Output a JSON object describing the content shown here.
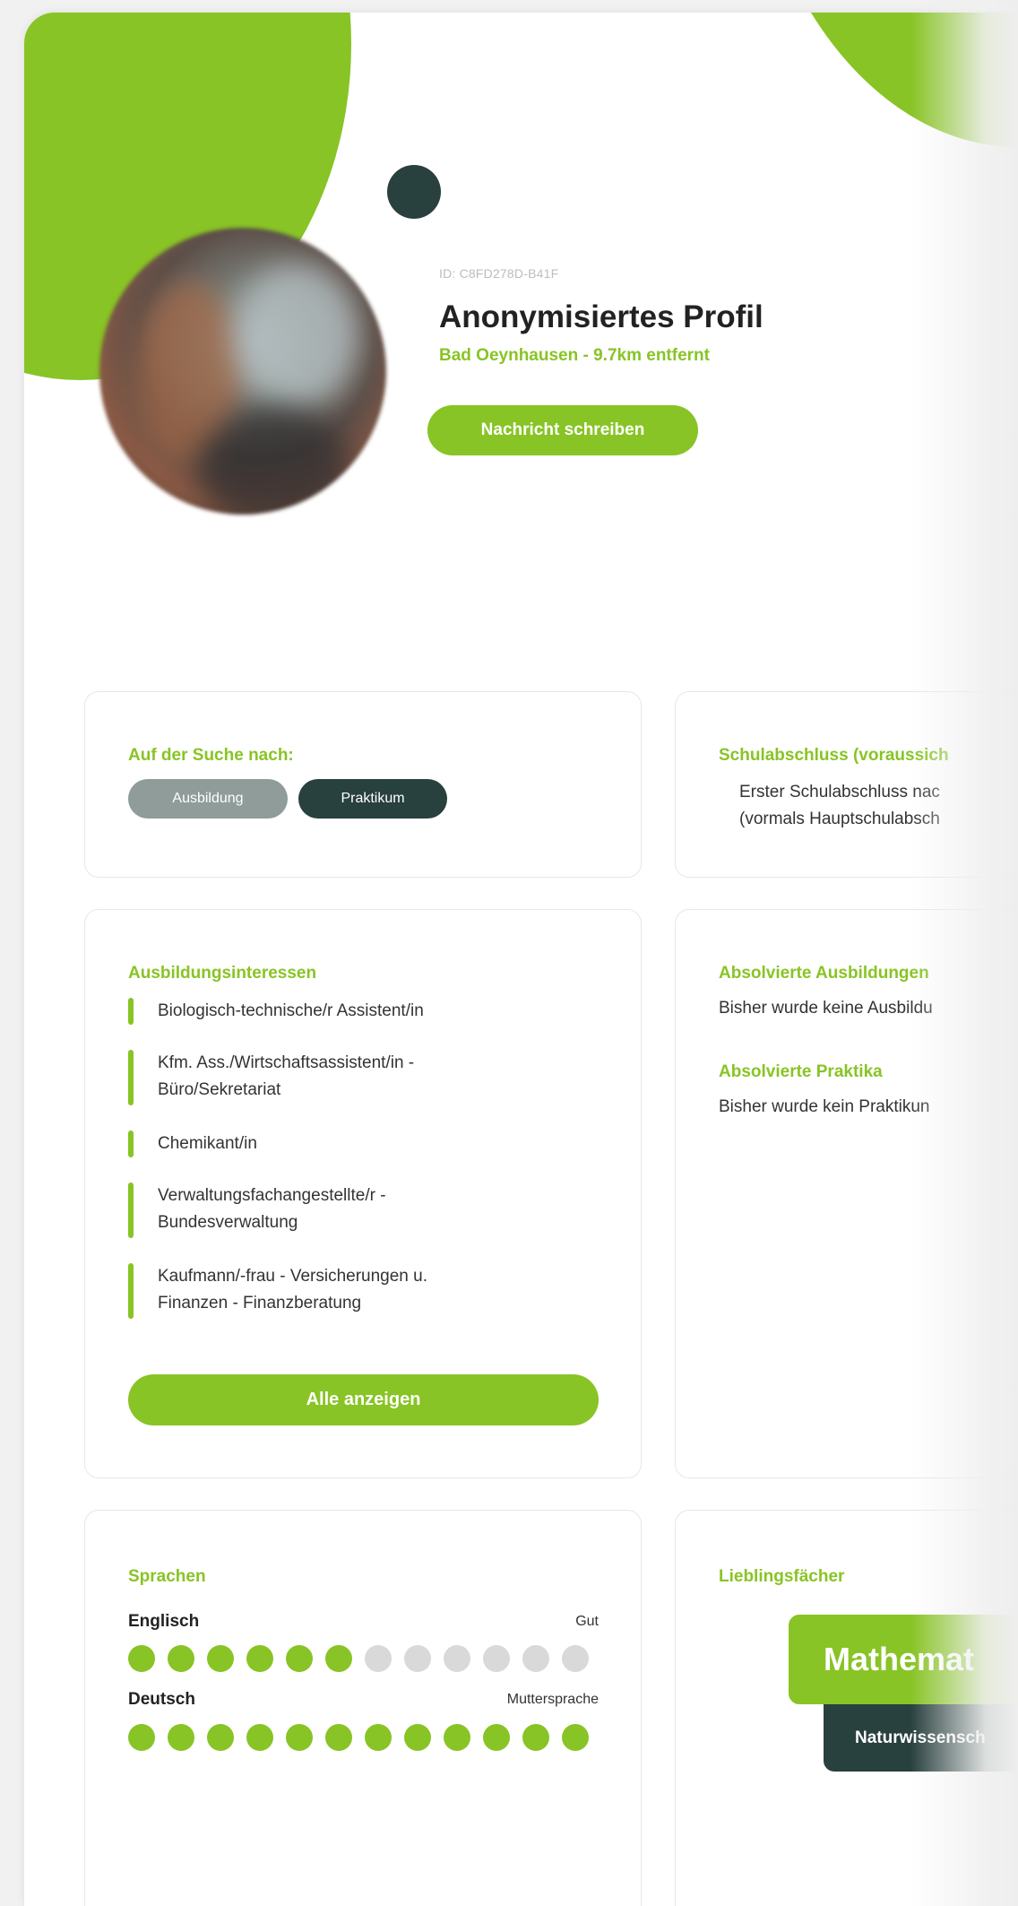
{
  "header": {
    "profile_id": "ID: C8FD278D-B41F",
    "name": "Anonymisiertes Profil",
    "location": "Bad Oeynhausen - 9.7km entfernt",
    "message_button": "Nachricht schreiben"
  },
  "search": {
    "title": "Auf der Suche nach:",
    "tags": [
      "Ausbildung",
      "Praktikum"
    ]
  },
  "school": {
    "title": "Schulabschluss (voraussich",
    "line1": "Erster Schulabschluss nac",
    "line2": "(vormals Hauptschulabsch"
  },
  "interests": {
    "title": "Ausbildungsinteressen",
    "items": [
      {
        "l1": "Biologisch-technische/r Assistent/in",
        "l2": ""
      },
      {
        "l1": "Kfm. Ass./Wirtschaftsassistent/in -",
        "l2": "Büro/Sekretariat"
      },
      {
        "l1": "Chemikant/in",
        "l2": ""
      },
      {
        "l1": "Verwaltungsfachangestellte/r -",
        "l2": "Bundesverwaltung"
      },
      {
        "l1": "Kaufmann/-frau - Versicherungen u.",
        "l2": "Finanzen - Finanzberatung"
      }
    ],
    "show_all": "Alle anzeigen"
  },
  "completed": {
    "training_title": "Absolvierte Ausbildungen",
    "training_text": "Bisher wurde keine Ausbildu",
    "internship_title": "Absolvierte Praktika",
    "internship_text": "Bisher wurde kein Praktikun"
  },
  "languages": {
    "title": "Sprachen",
    "items": [
      {
        "name": "Englisch",
        "level": "Gut",
        "rating": 6,
        "max": 12
      },
      {
        "name": "Deutsch",
        "level": "Muttersprache",
        "rating": 12,
        "max": 12
      }
    ]
  },
  "favorites": {
    "title": "Lieblingsfächer",
    "primary": "Mathemat",
    "secondary": "Naturwissensch"
  },
  "colors": {
    "accent": "#88c425",
    "dark": "#28403e",
    "grey_tag": "#8f9c99",
    "dot_off": "#d9d9d9"
  }
}
